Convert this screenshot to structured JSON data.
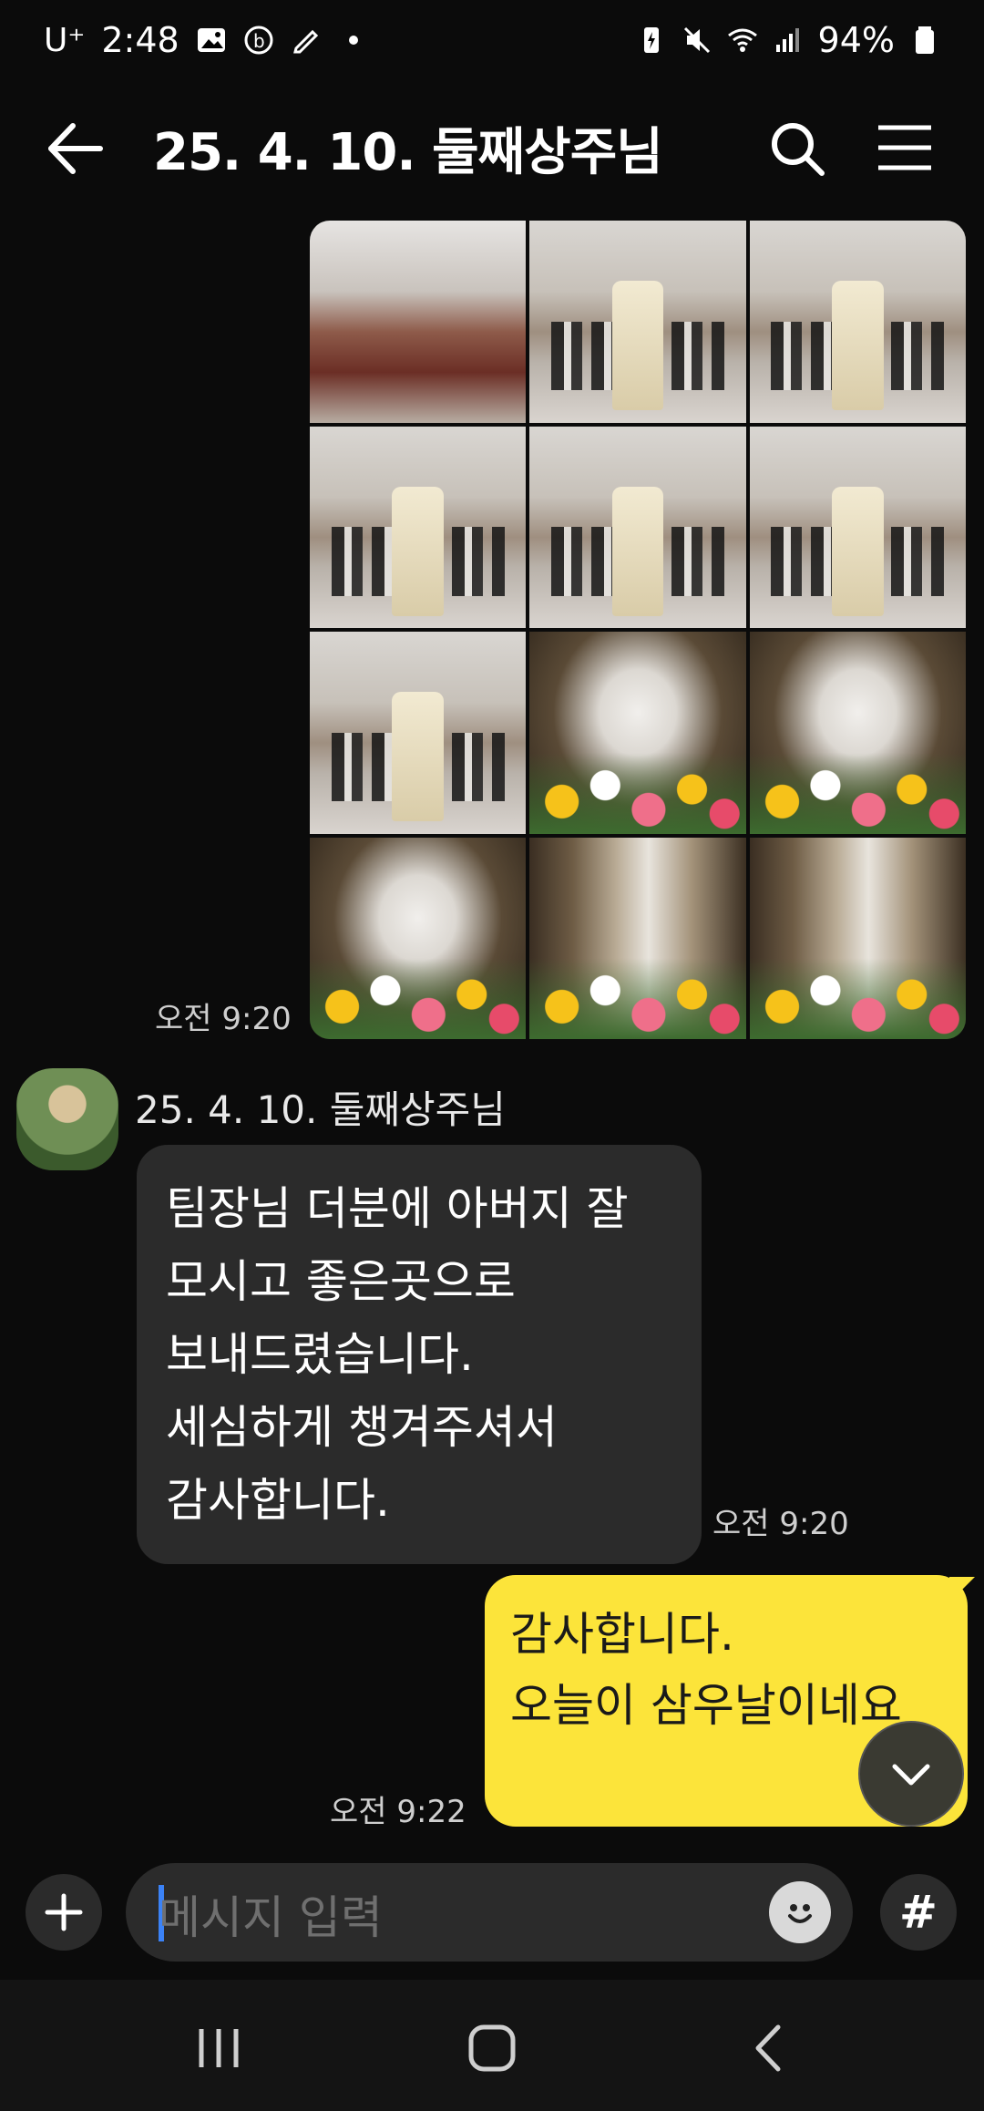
{
  "status": {
    "carrier": "U⁺",
    "time": "2:48",
    "battery": "94%"
  },
  "header": {
    "title": "25. 4. 10. 둘째상주님"
  },
  "photos": {
    "time": "오전 9:20",
    "tiles": [
      "pews",
      "church",
      "church",
      "church",
      "church",
      "church",
      "church",
      "urn",
      "urn",
      "urn",
      "niche",
      "niche"
    ]
  },
  "incoming": {
    "sender": "25. 4. 10. 둘째상주님",
    "lines": [
      "팀장님 더분에 아버지 잘",
      "모시고 좋은곳으로",
      "보내드렸습니다.",
      "세심하게 챙겨주셔서",
      "감사합니다."
    ],
    "time": "오전 9:20"
  },
  "outgoing": {
    "lines": [
      "감사합니다.",
      "오늘이 삼우날이네요"
    ],
    "time": "오전 9:22"
  },
  "composer": {
    "placeholder": "메시지 입력",
    "hash": "#"
  },
  "colors": {
    "bubble_out": "#fce43a",
    "bubble_in": "#2b2b2b",
    "background": "#0b0b0b"
  }
}
